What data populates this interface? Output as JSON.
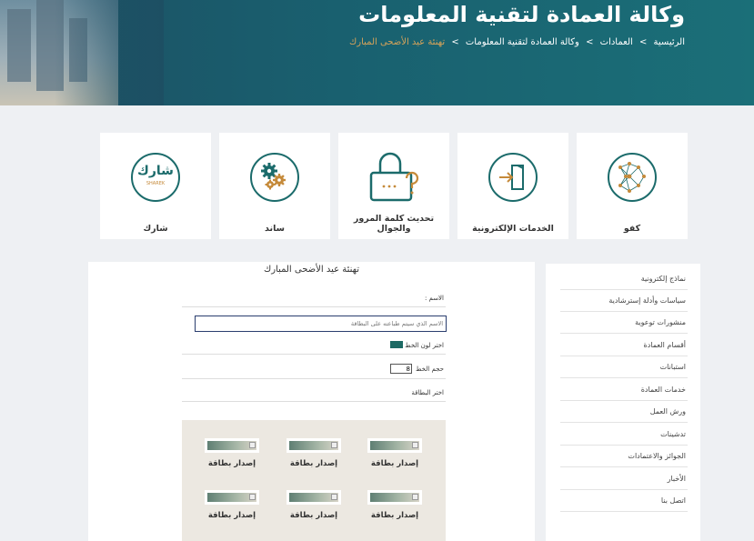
{
  "header": {
    "title": "وكالة العمادة لتقنية المعلومات",
    "breadcrumb": {
      "home": "الرئيسية",
      "deanships": "العمادات",
      "agency": "وكالة العمادة لتقنية المعلومات",
      "current": "تهنئة عيد الأضحى المبارك",
      "separator": ">"
    }
  },
  "services": [
    {
      "label": "كفو",
      "icon": "kafu-network-icon"
    },
    {
      "label": "الخدمات الإلكترونية",
      "icon": "exit-door-icon"
    },
    {
      "label": "تحديث كلمة المرور والجوال",
      "icon": "lock-question-icon"
    },
    {
      "label": "ساند",
      "icon": "gears-icon"
    },
    {
      "label": "شارك",
      "icon": "share-logo-icon",
      "logo_text": "شارك",
      "logo_sub": "SHAREK"
    }
  ],
  "form": {
    "title": "تهنئة عيد الأضحى المبارك",
    "name_label": "الاسم :",
    "name_placeholder": "الاسم الذي سيتم طباعته على البطاقة",
    "color_label": "اختر لون الخط",
    "color_value": "#1d6a64",
    "size_label": "حجم الخط",
    "size_value": "8",
    "card_label": "اختر البطاقة",
    "issue_label": "إصدار بطاقة"
  },
  "sidebar": {
    "items": [
      "نماذج إلكترونية",
      "سياسات وأدلة إسترشادية",
      "منشورات توعوية",
      "أقسام العمادة",
      "استبانات",
      "خدمات العمادة",
      "ورش العمل",
      "تدشينات",
      "الجوائز والاعتمادات",
      "الأخبار",
      "اتصل بنا"
    ]
  },
  "colors": {
    "accent": "#1b6b6b",
    "gold": "#d6a35a",
    "header": "#1d4f63"
  }
}
